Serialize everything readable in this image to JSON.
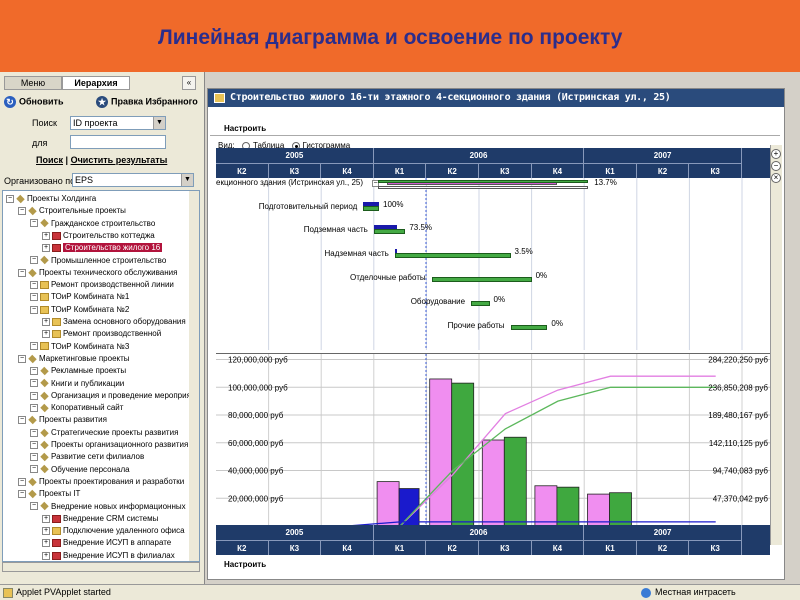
{
  "banner": {
    "title": "Линейная диаграмма и освоение по проекту"
  },
  "left_panel": {
    "tabs": [
      {
        "label": "Меню"
      },
      {
        "label": "Иерархия"
      }
    ],
    "collapse_label": "«",
    "refresh_label": "Обновить",
    "favorites_label": "Правка Избранного",
    "search_label": "Поиск",
    "search_value": "ID проекта",
    "for_label": "для",
    "search_link": "Поиск",
    "clear_link": "Очистить результаты",
    "organized_label": "Организовано по",
    "organized_value": "EPS",
    "tree": [
      {
        "label": "Проекты Холдинга",
        "level": 0,
        "icon": "diamond"
      },
      {
        "label": "Строительные проекты",
        "level": 1,
        "icon": "diamond"
      },
      {
        "label": "Гражданское строительство",
        "level": 2,
        "icon": "diamond"
      },
      {
        "label": "Строительство коттеджа",
        "level": 3,
        "icon": "red"
      },
      {
        "label": "Строительство жилого 16",
        "level": 3,
        "icon": "red",
        "selected": true
      },
      {
        "label": "Промышленное строительство",
        "level": 2,
        "icon": "diamond"
      },
      {
        "label": "Проекты технического обслуживания",
        "level": 1,
        "icon": "diamond"
      },
      {
        "label": "Ремонт производственной линии",
        "level": 2,
        "icon": "folder"
      },
      {
        "label": "ТОиР Комбината №1",
        "level": 2,
        "icon": "folder"
      },
      {
        "label": "ТОиР Комбината №2",
        "level": 2,
        "icon": "folder"
      },
      {
        "label": "Замена основного оборудования",
        "level": 3,
        "icon": "folder"
      },
      {
        "label": "Ремонт производственной",
        "level": 3,
        "icon": "folder"
      },
      {
        "label": "ТОиР Комбината №3",
        "level": 2,
        "icon": "folder"
      },
      {
        "label": "Маркетинговые проекты",
        "level": 1,
        "icon": "diamond"
      },
      {
        "label": "Рекламные проекты",
        "level": 2,
        "icon": "diamond"
      },
      {
        "label": "Книги и публикации",
        "level": 2,
        "icon": "diamond"
      },
      {
        "label": "Организация и проведение мероприятий",
        "level": 2,
        "icon": "diamond"
      },
      {
        "label": "Копоративный сайт",
        "level": 2,
        "icon": "diamond"
      },
      {
        "label": "Проекты развития",
        "level": 1,
        "icon": "diamond"
      },
      {
        "label": "Стратегические проекты развития",
        "level": 2,
        "icon": "diamond"
      },
      {
        "label": "Проекты организационного развития",
        "level": 2,
        "icon": "diamond"
      },
      {
        "label": "Развитие сети филиалов",
        "level": 2,
        "icon": "diamond"
      },
      {
        "label": "Обучение персонала",
        "level": 2,
        "icon": "diamond"
      },
      {
        "label": "Проекты проектирования и разработки",
        "level": 1,
        "icon": "diamond"
      },
      {
        "label": "Проекты IT",
        "level": 1,
        "icon": "diamond"
      },
      {
        "label": "Внедрение новых информационных",
        "level": 2,
        "icon": "diamond"
      },
      {
        "label": "Внедрение CRM системы",
        "level": 3,
        "icon": "red"
      },
      {
        "label": "Подключение удаленного офиса",
        "level": 3,
        "icon": "folder"
      },
      {
        "label": "Внедрение ИСУП в аппарате",
        "level": 3,
        "icon": "red"
      },
      {
        "label": "Внедрение ИСУП в филиалах",
        "level": 3,
        "icon": "red"
      }
    ]
  },
  "right_panel": {
    "title": "Строительство жилого 16-ти этажного 4-секционного здания (Истринская ул., 25)",
    "setup_label": "Настроить",
    "view_label": "Вид:",
    "view_options": [
      {
        "label": "Таблица",
        "selected": false
      },
      {
        "label": "Гистограмма",
        "selected": true
      }
    ],
    "timeline_top": {
      "years": [
        {
          "label": "2005",
          "quarters": 3
        },
        {
          "label": "2006",
          "quarters": 4
        },
        {
          "label": "2007",
          "quarters": 3
        }
      ],
      "quarters": [
        "К2",
        "К3",
        "К4",
        "К1",
        "К2",
        "К3",
        "К4",
        "К1",
        "К2",
        "К3"
      ]
    },
    "timeline_bottom": {
      "years": [
        {
          "label": "2005",
          "quarters": 3
        },
        {
          "label": "2006",
          "quarters": 4
        },
        {
          "label": "2007",
          "quarters": 3
        }
      ],
      "quarters": [
        "К2",
        "К3",
        "К4",
        "К1",
        "К2",
        "К3",
        "К4",
        "К1",
        "К2",
        "К3"
      ]
    },
    "gantt": [
      {
        "label": "екционного здания (Истринская ул., 25)",
        "pct": "13.7%",
        "type": "summary",
        "plan_start": 3.0,
        "plan_end": 7.0,
        "act_start": 0.3,
        "act_end": 3.0
      },
      {
        "label": "Подготовительный период",
        "pct": "100%",
        "type": "task",
        "plan_start": 2.8,
        "plan_end": 3.1,
        "act_start": 2.8,
        "act_end": 3.1
      },
      {
        "label": "Подземная часть",
        "pct": "73.5%",
        "type": "task",
        "plan_start": 3.0,
        "plan_end": 3.6,
        "act_start": 3.0,
        "act_end": 3.45
      },
      {
        "label": "Надземная часть",
        "pct": "3.5%",
        "type": "task",
        "plan_start": 3.4,
        "plan_end": 5.6,
        "act_start": 3.4,
        "act_end": 3.45
      },
      {
        "label": "Отделочные работы",
        "pct": "0%",
        "type": "task",
        "plan_start": 4.1,
        "plan_end": 6.0,
        "act_start": null,
        "act_end": null
      },
      {
        "label": "Оборудование",
        "pct": "0%",
        "type": "task",
        "plan_start": 4.85,
        "plan_end": 5.2,
        "act_start": null,
        "act_end": null
      },
      {
        "label": "Прочие работы",
        "pct": "0%",
        "type": "task",
        "plan_start": 5.6,
        "plan_end": 6.3,
        "act_start": null,
        "act_end": null
      }
    ],
    "chart_data": {
      "type": "bar",
      "categories": [
        "К2 2005",
        "К3 2005",
        "К4 2005",
        "К1 2006",
        "К2 2006",
        "К3 2006",
        "К4 2006",
        "К1 2007",
        "К2 2007",
        "К3 2007"
      ],
      "series": [
        {
          "color": "#f08ef0",
          "values": [
            0,
            0,
            0,
            32000000,
            106000000,
            62000000,
            29000000,
            23000000,
            0,
            0
          ]
        },
        {
          "color": "#3fa83f",
          "values": [
            0,
            0,
            0,
            0,
            103000000,
            64000000,
            28000000,
            24000000,
            0,
            0
          ]
        },
        {
          "color": "#1a1acc",
          "values": [
            0,
            0,
            0,
            27000000,
            0,
            0,
            0,
            0,
            0,
            0
          ]
        }
      ],
      "cumulative_series": [
        {
          "color": "#e27fe2",
          "values": [
            0,
            0,
            0,
            0,
            37000000,
            81000000,
            98000000,
            108000000,
            108000000,
            108000000
          ]
        },
        {
          "color": "#5cb85c",
          "values": [
            0,
            0,
            0,
            0,
            40000000,
            70000000,
            90000000,
            100000000,
            100000000,
            100000000
          ]
        },
        {
          "color": "#1a1acc",
          "values": [
            0,
            0,
            0,
            3000000,
            3000000,
            3000000,
            3000000,
            3000000,
            3000000,
            3000000
          ]
        }
      ],
      "left_ticks": [
        {
          "value": 20000000,
          "label": "20,000,000 руб"
        },
        {
          "value": 40000000,
          "label": "40,000,000 руб"
        },
        {
          "value": 60000000,
          "label": "60,000,000 руб"
        },
        {
          "value": 80000000,
          "label": "80,000,000 руб"
        },
        {
          "value": 100000000,
          "label": "100,000,000 руб"
        },
        {
          "value": 120000000,
          "label": "120,000,000 руб"
        }
      ],
      "right_ticks": [
        {
          "value": 20000000,
          "label": "47,370,042 руб"
        },
        {
          "value": 40000000,
          "label": "94,740,083 руб"
        },
        {
          "value": 60000000,
          "label": "142,110,125 руб"
        },
        {
          "value": 80000000,
          "label": "189,480,167 руб"
        },
        {
          "value": 100000000,
          "label": "236,850,208 руб"
        },
        {
          "value": 120000000,
          "label": "284,220,250 руб"
        }
      ],
      "ylim": [
        0,
        124000000
      ],
      "grid": true,
      "legend": "none"
    }
  },
  "status_bar": {
    "left": "Applet PVApplet started",
    "right": "Местная интрасеть"
  }
}
